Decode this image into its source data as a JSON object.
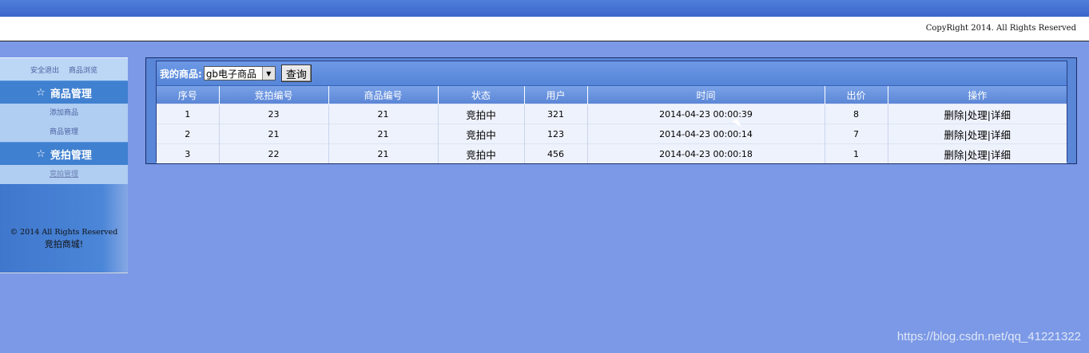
{
  "header": {
    "copyright": "CopyRight 2014. All Rights Reserved"
  },
  "sidebar": {
    "links": [
      "安全退出",
      "商品浏览"
    ],
    "sections": [
      {
        "title": "商品管理",
        "items": [
          "添加商品",
          "商品管理"
        ]
      },
      {
        "title": "竞拍管理",
        "items": [
          "竞拍管理"
        ]
      }
    ],
    "footer_line1": "© 2014 All Rights Reserved",
    "footer_line2": "竞拍商城!"
  },
  "main": {
    "filter_label": "我的商品:",
    "select_value": "gb电子商品",
    "query_button": "查询",
    "columns": [
      "序号",
      "竞拍编号",
      "商品编号",
      "状态",
      "用户",
      "时间",
      "出价",
      "操作"
    ],
    "rows": [
      {
        "seq": "1",
        "auction_id": "23",
        "goods_id": "21",
        "status": "竞拍中",
        "user": "321",
        "time": "2014-04-23 00:00:39",
        "bid": "8"
      },
      {
        "seq": "2",
        "auction_id": "21",
        "goods_id": "21",
        "status": "竞拍中",
        "user": "123",
        "time": "2014-04-23 00:00:14",
        "bid": "7"
      },
      {
        "seq": "3",
        "auction_id": "22",
        "goods_id": "21",
        "status": "竞拍中",
        "user": "456",
        "time": "2014-04-23 00:00:18",
        "bid": "1"
      }
    ],
    "actions": {
      "delete": "删除",
      "process": "处理",
      "detail": "详细",
      "sep": "|"
    }
  },
  "watermark": "https://blog.csdn.net/qq_41221322"
}
